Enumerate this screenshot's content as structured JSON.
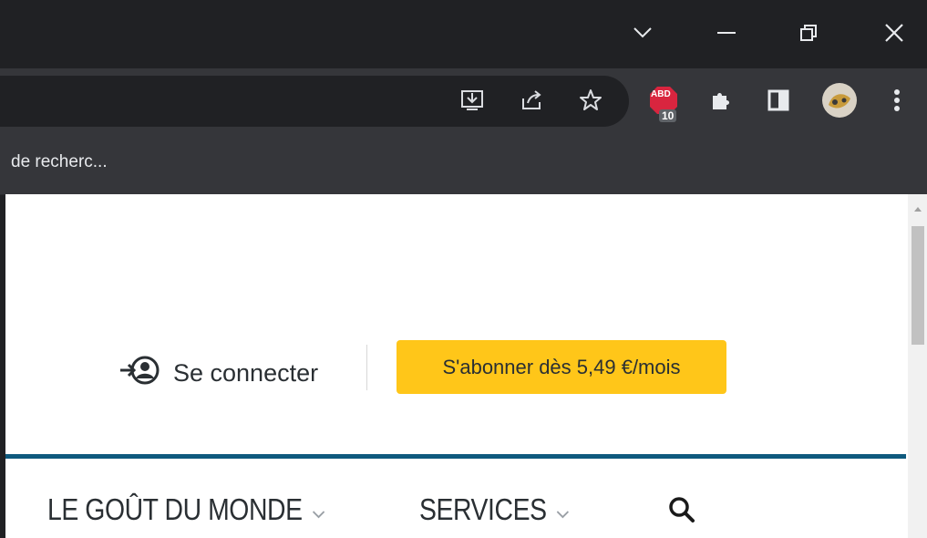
{
  "window": {
    "controls": [
      "tab-search",
      "minimize",
      "restore",
      "close"
    ]
  },
  "toolbar": {
    "extension_badge_top": "ABD",
    "extension_badge_count": "10"
  },
  "bookmarks": {
    "item_label": "de recherc..."
  },
  "page": {
    "login_label": "Se connecter",
    "subscribe_label": "S'abonner dès 5,49 €/mois",
    "nav": [
      {
        "label": "LE GOÛT DU MONDE"
      },
      {
        "label": "SERVICES"
      }
    ]
  },
  "colors": {
    "accent_yellow": "#ffc619",
    "rule_blue": "#0f5a7e",
    "text_dark": "#2a2f33"
  }
}
